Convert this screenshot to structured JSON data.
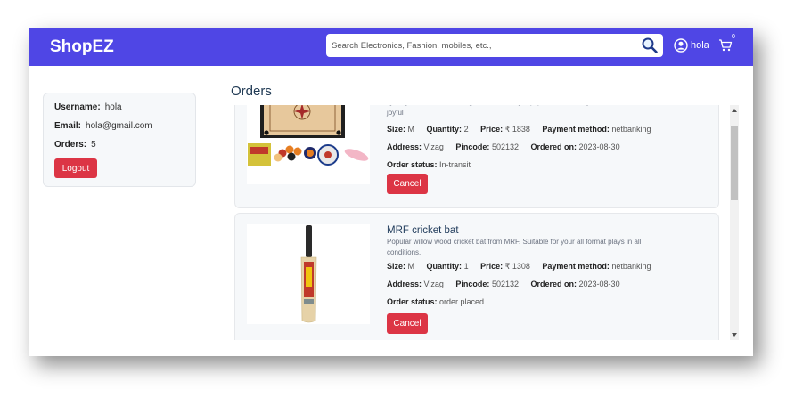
{
  "app": {
    "brand": "ShopEZ",
    "accent_color": "#4f46e5"
  },
  "search": {
    "placeholder": "Search Electronics, Fashion, mobiles, etc.,"
  },
  "user": {
    "name": "hola"
  },
  "cart": {
    "count": "0"
  },
  "profile": {
    "username_label": "Username:",
    "username": "hola",
    "email_label": "Email:",
    "email": "hola@gmail.com",
    "orders_label": "Orders:",
    "orders": "5",
    "logout_label": "Logout"
  },
  "orders_title": "Orders",
  "labels": {
    "size": "Size:",
    "quantity": "Quantity:",
    "price": "Price:",
    "payment": "Payment method:",
    "address": "Address:",
    "pincode": "Pincode:",
    "ordered_on": "Ordered on:",
    "status": "Order status:",
    "cancel": "Cancel"
  },
  "orders": [
    {
      "title": "",
      "description": "Quality carrom board along with necessary equipment to make your free time more joyful",
      "size": "M",
      "quantity": "2",
      "price": "₹ 1838",
      "payment": "netbanking",
      "address": "Vizag",
      "pincode": "502132",
      "ordered_on": "2023-08-30",
      "status": "In-transit"
    },
    {
      "title": "MRF cricket bat",
      "description": "Popular willow wood cricket bat from MRF. Suitable for your all format plays in all conditions.",
      "size": "M",
      "quantity": "1",
      "price": "₹ 1308",
      "payment": "netbanking",
      "address": "Vizag",
      "pincode": "502132",
      "ordered_on": "2023-08-30",
      "status": "order placed"
    }
  ]
}
